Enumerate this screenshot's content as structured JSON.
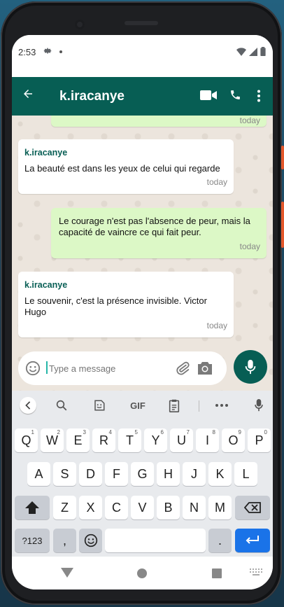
{
  "status": {
    "time": "2:53"
  },
  "header": {
    "title": "k.iracanye"
  },
  "messages": [
    {
      "direction": "out",
      "time": "today"
    },
    {
      "direction": "in",
      "sender": "k.iracanye",
      "text": "La beauté est dans les yeux de celui qui regarde",
      "time": "today"
    },
    {
      "direction": "out",
      "text": "Le courage n'est pas l'absence de peur, mais la capacité de vaincre ce qui fait peur.",
      "time": "today"
    },
    {
      "direction": "in",
      "sender": "k.iracanye",
      "text": "Le souvenir, c'est la présence invisible. Victor Hugo",
      "time": "today"
    }
  ],
  "composer": {
    "placeholder": "Type a message"
  },
  "keyboard": {
    "gif_label": "GIF",
    "row1": [
      {
        "k": "Q",
        "h": "1"
      },
      {
        "k": "W",
        "h": "2"
      },
      {
        "k": "E",
        "h": "3"
      },
      {
        "k": "R",
        "h": "4"
      },
      {
        "k": "T",
        "h": "5"
      },
      {
        "k": "Y",
        "h": "6"
      },
      {
        "k": "U",
        "h": "7"
      },
      {
        "k": "I",
        "h": "8"
      },
      {
        "k": "O",
        "h": "9"
      },
      {
        "k": "P",
        "h": "0"
      }
    ],
    "row2": [
      "A",
      "S",
      "D",
      "F",
      "G",
      "H",
      "J",
      "K",
      "L"
    ],
    "row3": [
      "Z",
      "X",
      "C",
      "V",
      "B",
      "N",
      "M"
    ],
    "symbols_key": "?123",
    "comma_key": ",",
    "period_key": "."
  },
  "colors": {
    "header": "#075e54",
    "outgoing": "#dcf8c6",
    "incoming": "#ffffff",
    "chat_bg": "#ece5dd",
    "enter_key": "#1a73e8"
  }
}
